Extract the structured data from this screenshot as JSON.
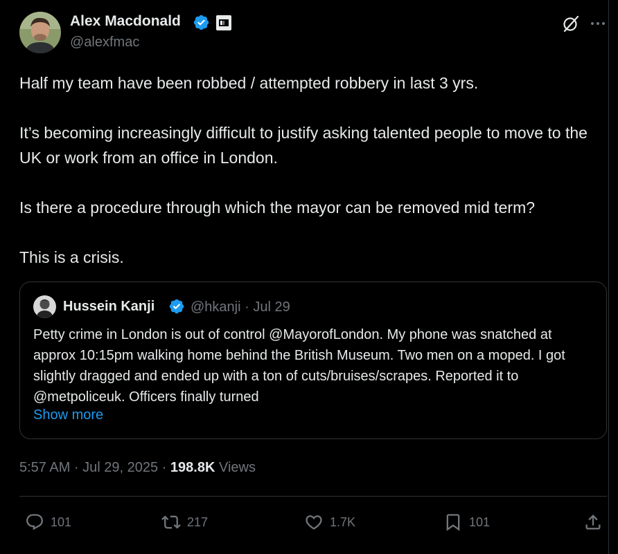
{
  "author": {
    "name": "Alex Macdonald",
    "handle": "@alexfmac"
  },
  "tweet": {
    "paragraphs": [
      "Half my team have been robbed / attempted robbery in last 3 yrs.",
      "It’s becoming increasingly difficult to justify asking talented people to move to the UK or work from an office in London.",
      "Is there a procedure through which the mayor can be removed mid term?",
      "This is a crisis."
    ]
  },
  "quote": {
    "name": "Hussein Kanji",
    "handle": "@hkanji",
    "date": "Jul 29",
    "meta": "@hkanji · Jul 29",
    "text": "Petty crime in London is out of control @MayorofLondon. My phone was snatched at approx 10:15pm walking home behind the British Museum. Two men on a moped. I got slightly dragged and ended up with a ton of cuts/bruises/scrapes. Reported it to @metpoliceuk. Officers finally turned",
    "show_more": "Show more"
  },
  "meta": {
    "time_date": "5:57 AM · Jul 29, 2025 · ",
    "views_count": "198.8K",
    "views_label": " Views"
  },
  "actions": {
    "replies": "101",
    "reposts": "217",
    "likes": "1.7K",
    "bookmarks": "101"
  },
  "icons": {
    "verified": "verified-badge-icon",
    "affiliate": "affiliate-badge-icon",
    "grok": "grok-icon",
    "more": "more-icon",
    "reply": "reply-icon",
    "repost": "repost-icon",
    "like": "heart-icon",
    "bookmark": "bookmark-icon",
    "share": "share-icon"
  },
  "colors": {
    "background": "#000000",
    "text": "#e7e9ea",
    "secondary": "#71767b",
    "accent": "#1d9bf0",
    "border": "#2f3336"
  }
}
